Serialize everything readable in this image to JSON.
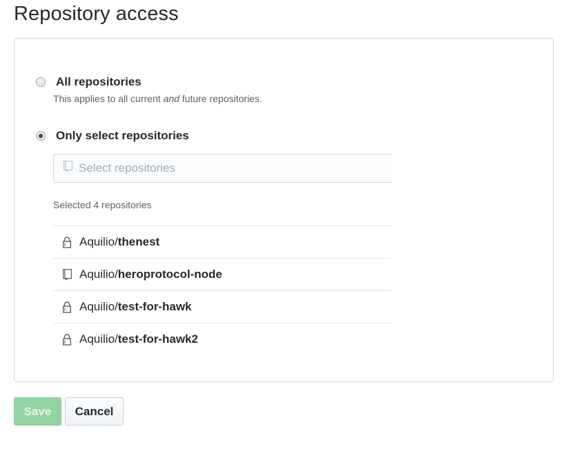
{
  "section": {
    "title": "Repository access"
  },
  "options": {
    "all": {
      "label": "All repositories",
      "note_before": "This applies to all current ",
      "note_em": "and",
      "note_after": " future repositories.",
      "checked": false
    },
    "select": {
      "label": "Only select repositories",
      "checked": true
    }
  },
  "repo_search": {
    "placeholder": "Select repositories",
    "icon": "repo-icon"
  },
  "selected_count": "Selected 4 repositories",
  "repositories": [
    {
      "owner": "Aquilio/",
      "name": "thenest",
      "icon": "lock-icon"
    },
    {
      "owner": "Aquilio/",
      "name": "heroprotocol-node",
      "icon": "repo-icon"
    },
    {
      "owner": "Aquilio/",
      "name": "test-for-hawk",
      "icon": "lock-icon"
    },
    {
      "owner": "Aquilio/",
      "name": "test-for-hawk2",
      "icon": "lock-icon"
    }
  ],
  "actions": {
    "save_label": "Save",
    "cancel_label": "Cancel"
  },
  "colors": {
    "save_bg": "#94d3a2",
    "border": "#d1d5da",
    "text": "#24292e",
    "muted": "#586069"
  }
}
